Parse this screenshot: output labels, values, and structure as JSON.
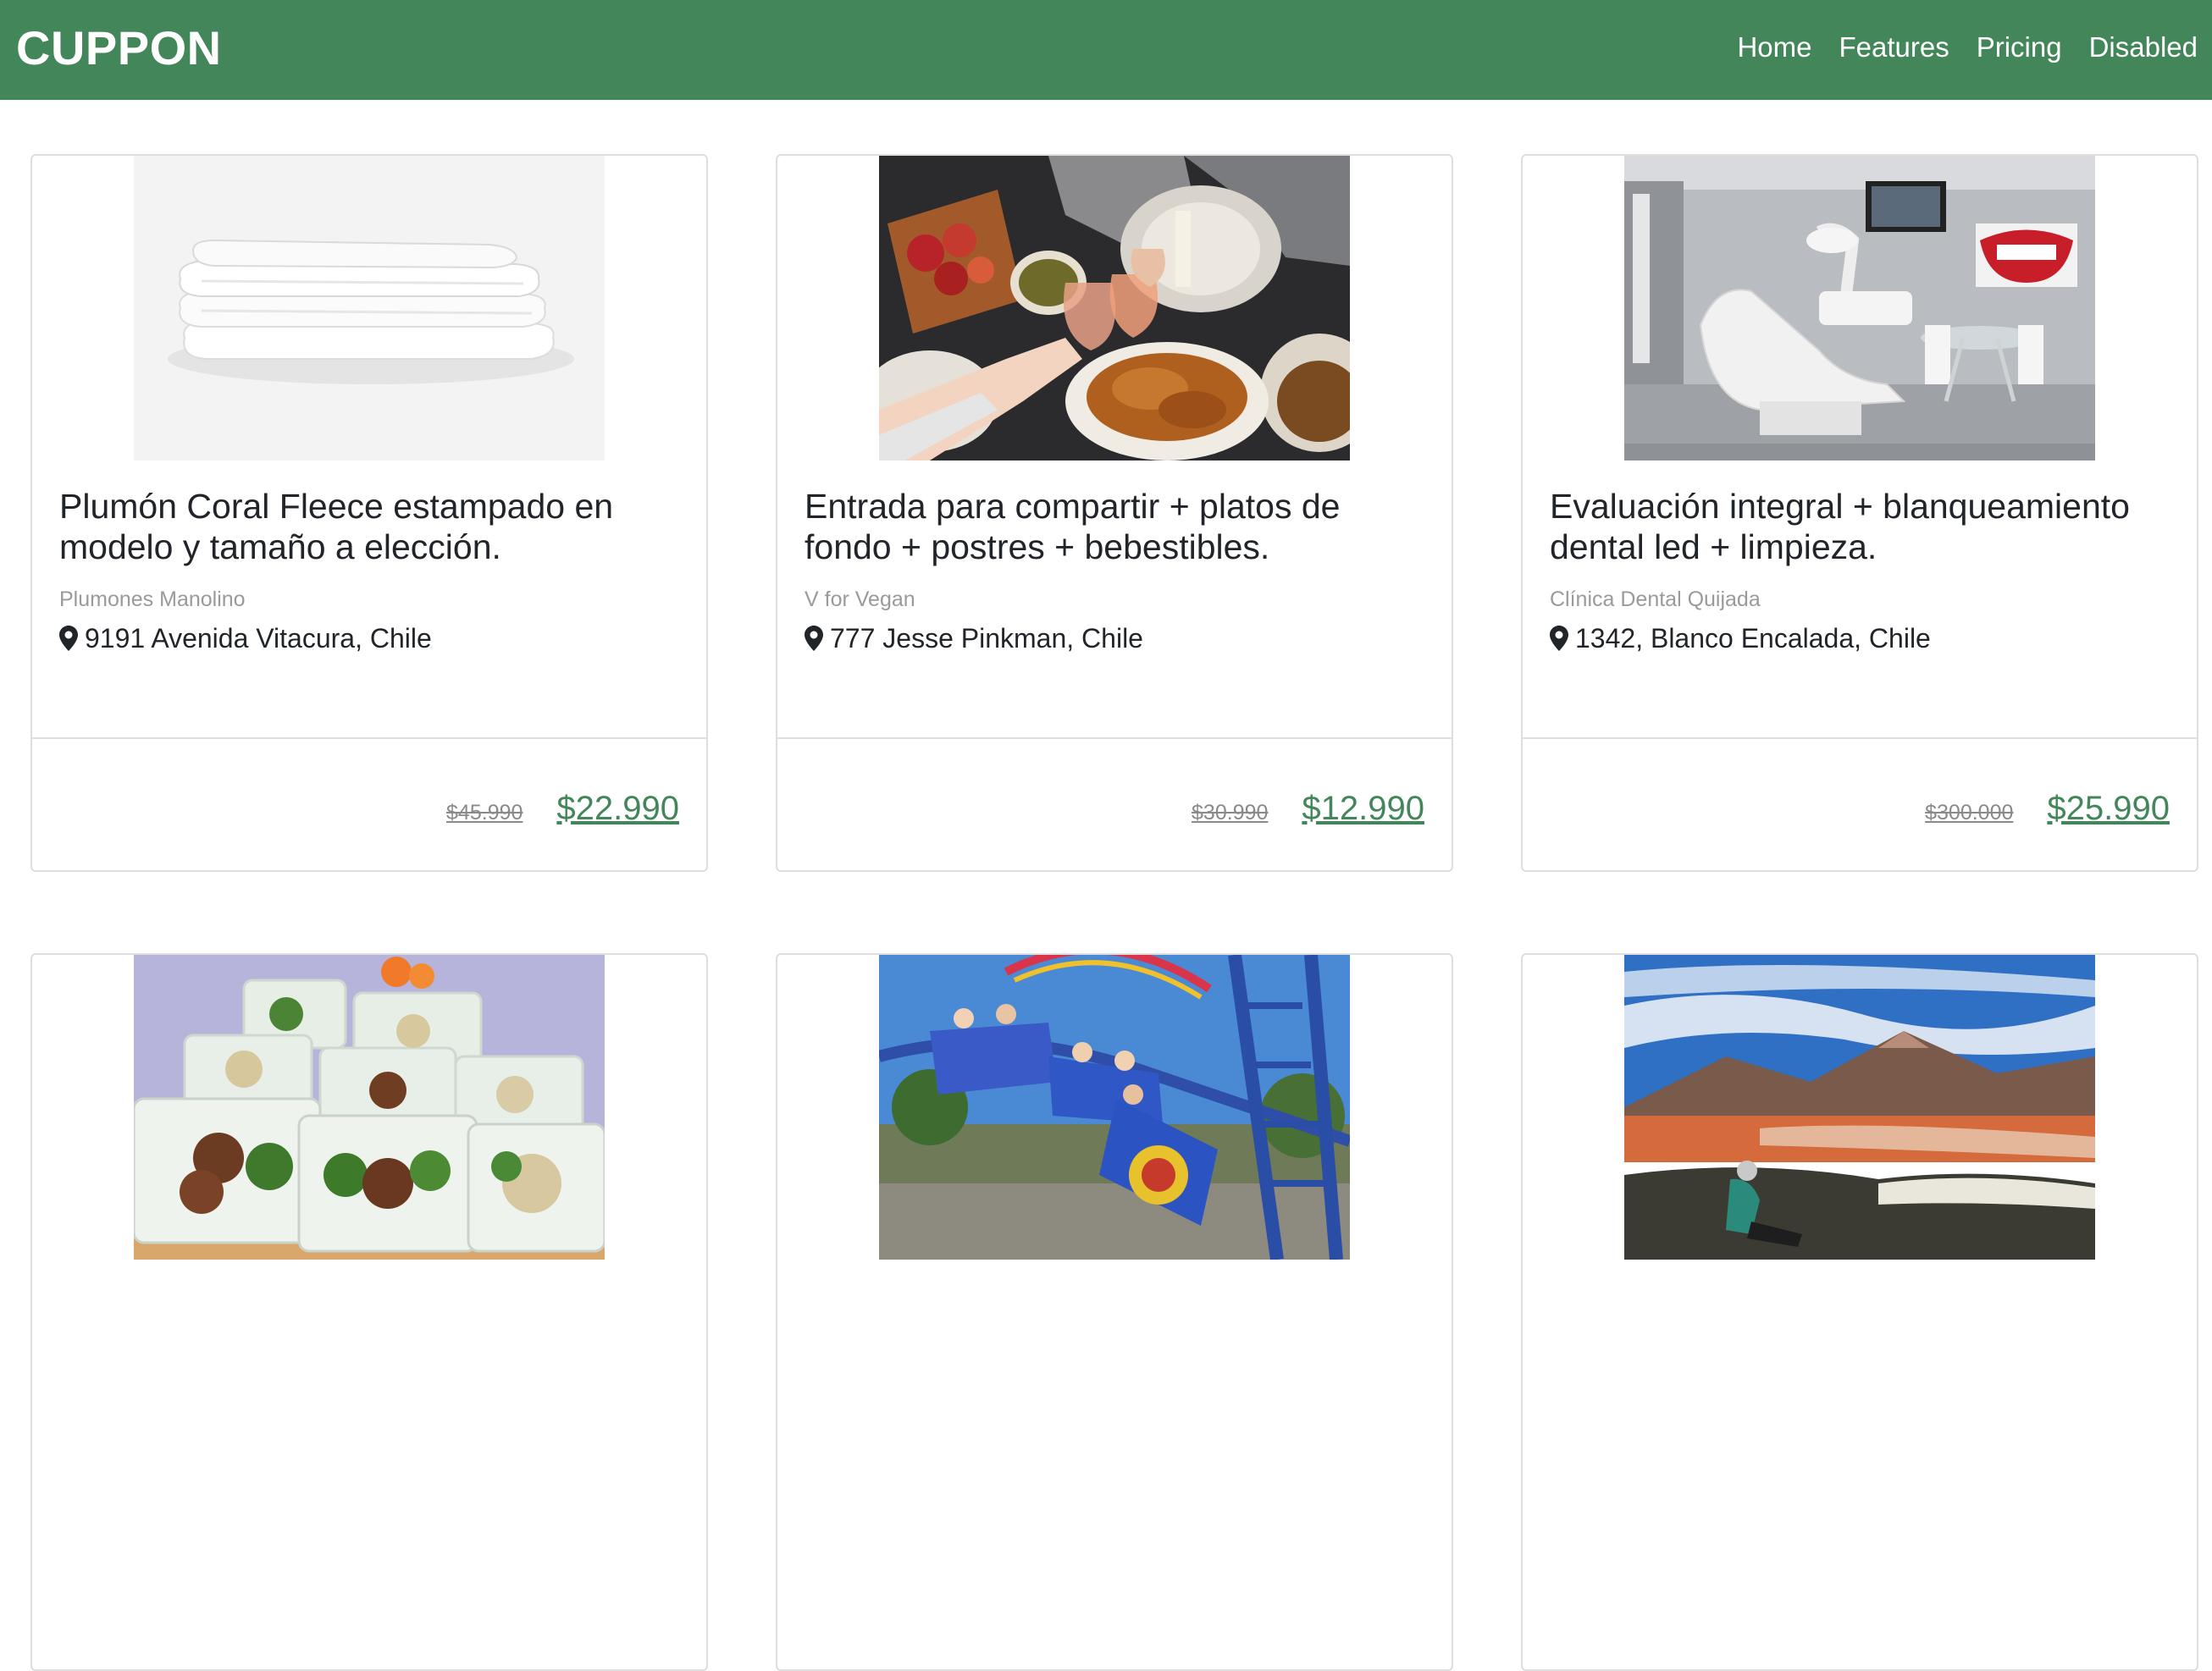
{
  "navbar": {
    "brand": "CUPPON",
    "links": [
      "Home",
      "Features",
      "Pricing",
      "Disabled"
    ],
    "background": "#43865a"
  },
  "cards": [
    {
      "title": "Plumón Coral Fleece estampado en modelo y tamaño a elección.",
      "merchant": "Plumones Manolino",
      "address": "9191 Avenida Vitacura, Chile",
      "old_price": "$45.990",
      "new_price": "$22.990",
      "image": "duvet-image"
    },
    {
      "title": "Entrada para compartir + platos de fondo + postres + bebestibles.",
      "merchant": "V for Vegan",
      "address": "777 Jesse Pinkman, Chile",
      "old_price": "$30.990",
      "new_price": "$12.990",
      "image": "dinner-table-image"
    },
    {
      "title": "Evaluación integral + blanqueamiento dental led + limpieza.",
      "merchant": "Clínica Dental Quijada",
      "address": "1342, Blanco Encalada, Chile",
      "old_price": "$300.000",
      "new_price": "$25.990",
      "image": "dental-clinic-image"
    },
    {
      "title": "",
      "image": "meal-prep-image"
    },
    {
      "title": "",
      "image": "roller-coaster-image"
    },
    {
      "title": "",
      "image": "altiplano-lagoon-image"
    }
  ],
  "colors": {
    "accent": "#43865a",
    "border": "#dedede",
    "muted": "#9a9a9a"
  }
}
